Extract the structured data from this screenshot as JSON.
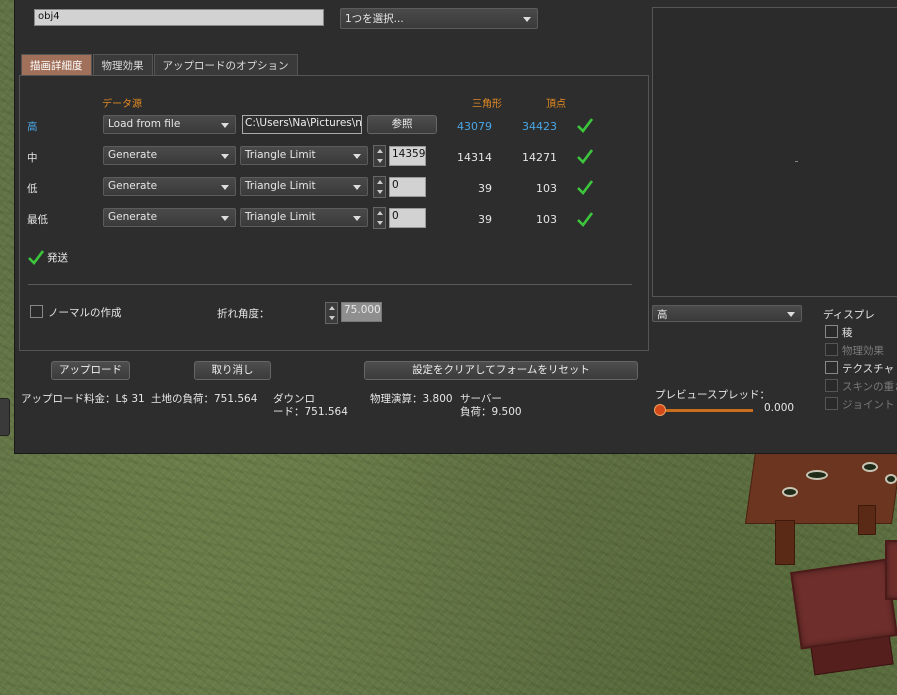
{
  "header": {
    "model_name": "obj4",
    "select_placeholder": "1つを選択..."
  },
  "tabs": [
    {
      "label": "描画詳細度",
      "active": true
    },
    {
      "label": "物理効果",
      "active": false
    },
    {
      "label": "アップロードのオプション",
      "active": false
    }
  ],
  "lod": {
    "col_source": "データ源",
    "col_triangles": "三角形",
    "col_vertices": "頂点",
    "rows": [
      {
        "label": "高",
        "source": "Load from file",
        "mode": "C:\\Users\\Na\\Pictures\\n",
        "browse": "参照",
        "triangles": "43079",
        "vertices": "34423",
        "highlight": true
      },
      {
        "label": "中",
        "source": "Generate",
        "mode": "Triangle Limit",
        "limit": "14359",
        "triangles": "14314",
        "vertices": "14271"
      },
      {
        "label": "低",
        "source": "Generate",
        "mode": "Triangle Limit",
        "limit": "0",
        "triangles": "39",
        "vertices": "103"
      },
      {
        "label": "最低",
        "source": "Generate",
        "mode": "Triangle Limit",
        "limit": "0",
        "triangles": "39",
        "vertices": "103"
      }
    ],
    "status": "発送"
  },
  "normals": {
    "checkbox_label": "ノーマルの作成",
    "crease_label": "折れ角度：",
    "crease_value": "75.000"
  },
  "buttons": {
    "upload": "アップロード",
    "cancel": "取り消し",
    "reset": "設定をクリアしてフォームをリセット"
  },
  "costs": {
    "upload_fee": "アップロード料金：L$ 31",
    "land_impact": "土地の負荷：751.564",
    "download_line1": "ダウンロ",
    "download_line2": "ード：751.564",
    "physics": "物理演算：3.800",
    "server_line1": "サーバー",
    "server_line2": "負荷：9.500"
  },
  "preview": {
    "lod_select": "高",
    "display_label": "ディスプレ",
    "options": [
      {
        "label": "稜",
        "enabled": true
      },
      {
        "label": "物理効果",
        "enabled": false
      },
      {
        "label": "テクスチャ",
        "enabled": true
      },
      {
        "label": "スキンの重さ",
        "enabled": false
      },
      {
        "label": "ジョイント",
        "enabled": false
      }
    ],
    "spread_label": "プレビュースプレッド：",
    "spread_value": "0.000"
  },
  "colors": {
    "accent_orange": "#e38a22",
    "highlight_blue": "#4aa6e6",
    "check_green": "#3cc63c"
  }
}
